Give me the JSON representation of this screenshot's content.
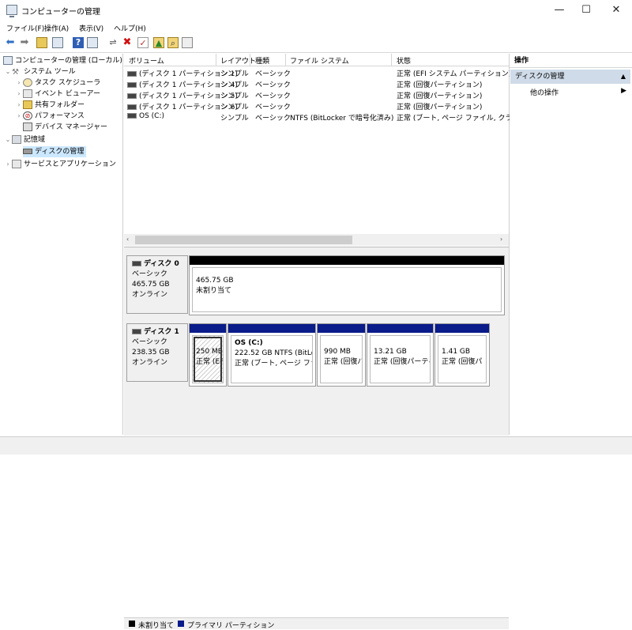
{
  "window": {
    "title": "コンピューターの管理",
    "min_glyph": "—",
    "max_glyph": "☐",
    "close_glyph": "✕"
  },
  "menu": [
    "ファイル(F)",
    "操作(A)",
    "表示(V)",
    "ヘルプ(H)"
  ],
  "tree": {
    "root": "コンピューターの管理 (ローカル)",
    "system_tools": "システム ツール",
    "task_scheduler": "タスク スケジューラ",
    "event_viewer": "イベント ビューアー",
    "shared_folders": "共有フォルダー",
    "performance": "パフォーマンス",
    "device_manager": "デバイス マネージャー",
    "storage": "記憶域",
    "disk_management": "ディスクの管理",
    "services_apps": "サービスとアプリケーション"
  },
  "volumes": {
    "headers": [
      "ボリューム",
      "レイアウト",
      "種類",
      "ファイル システム",
      "状態"
    ],
    "rows": [
      {
        "name": "(ディスク 1 パーティション 1)",
        "layout": "シンプル",
        "type": "ベーシック",
        "fs": "",
        "status": "正常 (EFI システム パーティション)"
      },
      {
        "name": "(ディスク 1 パーティション 4)",
        "layout": "シンプル",
        "type": "ベーシック",
        "fs": "",
        "status": "正常 (回復パーティション)"
      },
      {
        "name": "(ディスク 1 パーティション 5)",
        "layout": "シンプル",
        "type": "ベーシック",
        "fs": "",
        "status": "正常 (回復パーティション)"
      },
      {
        "name": "(ディスク 1 パーティション 6)",
        "layout": "シンプル",
        "type": "ベーシック",
        "fs": "",
        "status": "正常 (回復パーティション)"
      },
      {
        "name": "OS (C:)",
        "layout": "シンプル",
        "type": "ベーシック",
        "fs": "NTFS (BitLocker で暗号化済み)",
        "status": "正常 (ブート, ページ ファイル, クラッシュ"
      }
    ]
  },
  "disks": {
    "disk0": {
      "name": "ディスク 0",
      "type": "ベーシック",
      "size": "465.75 GB",
      "state": "オンライン",
      "part_size": "465.75 GB",
      "part_status": "未割り当て"
    },
    "disk1": {
      "name": "ディスク 1",
      "type": "ベーシック",
      "size": "238.35 GB",
      "state": "オンライン",
      "parts": [
        {
          "title": "",
          "size": "250 MB",
          "status": "正常 (EFI"
        },
        {
          "title": "OS  (C:)",
          "size": "222.52 GB NTFS (BitLock",
          "status": "正常 (ブート, ページ ファイル,"
        },
        {
          "title": "",
          "size": "990 MB",
          "status": "正常 (回復パ"
        },
        {
          "title": "",
          "size": "13.21 GB",
          "status": "正常 (回復パーティミ"
        },
        {
          "title": "",
          "size": "1.41 GB",
          "status": "正常 (回復パ"
        }
      ]
    }
  },
  "legend": {
    "unallocated": "未割り当て",
    "primary": "プライマリ パーティション"
  },
  "actions": {
    "header": "操作",
    "section": "ディスクの管理",
    "other": "他の操作"
  },
  "colors": {
    "primary_partition": "#0a1b8a",
    "unallocated": "#000000",
    "selection": "#cce8ff"
  }
}
